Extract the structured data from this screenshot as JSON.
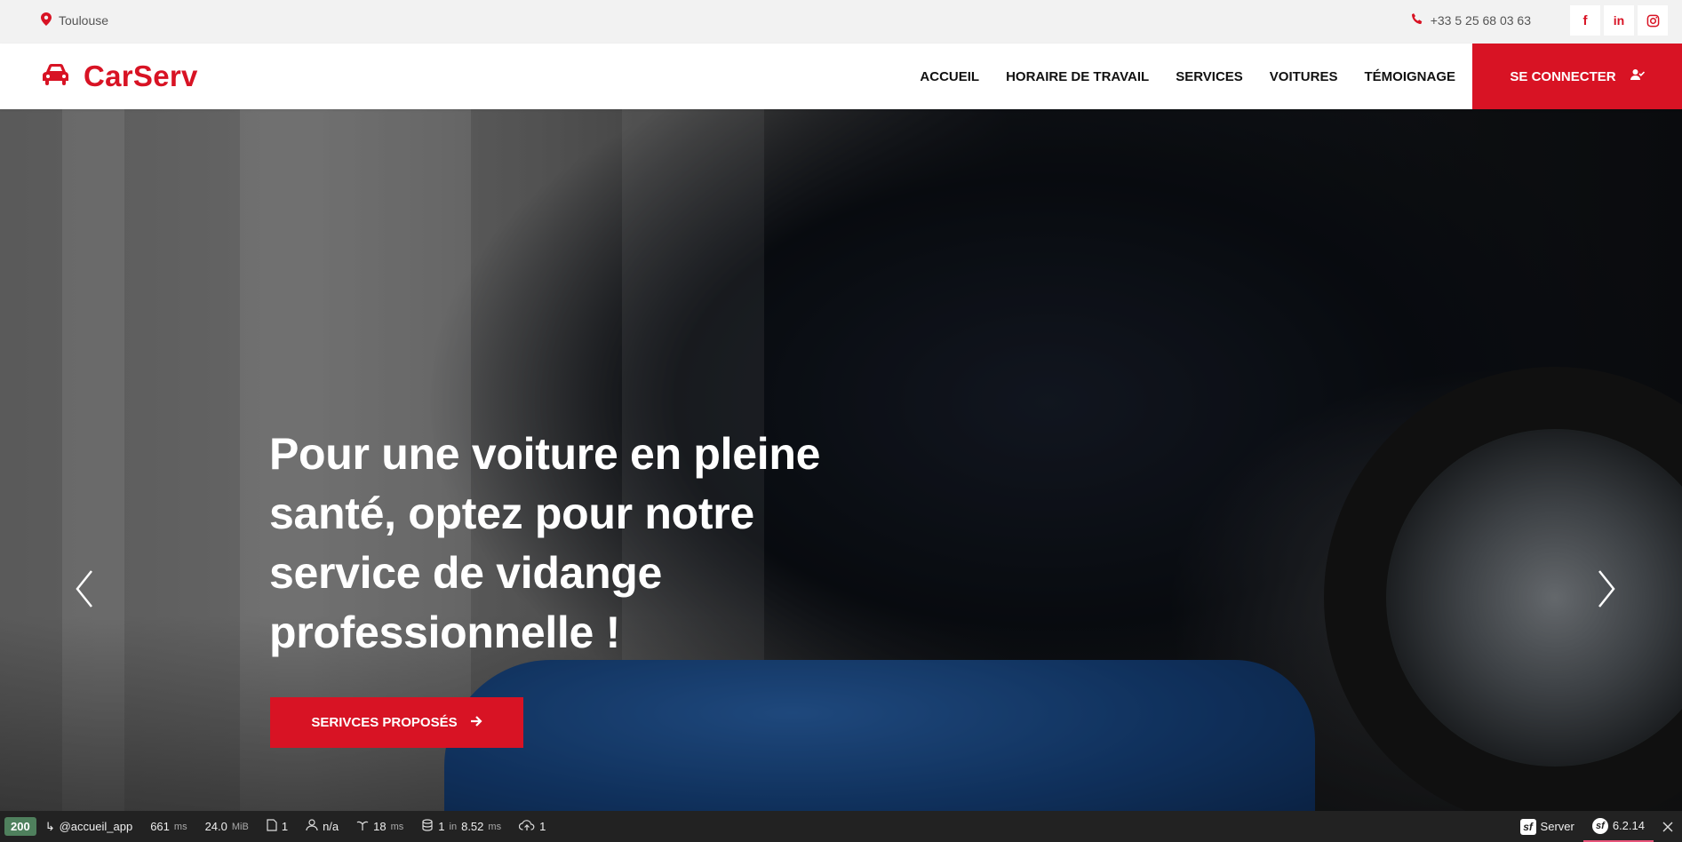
{
  "topbar": {
    "location": "Toulouse",
    "phone": "+33 5 25 68 03 63",
    "social": [
      "f",
      "in",
      "ig"
    ]
  },
  "navbar": {
    "brand": "CarServ",
    "links": [
      "ACCUEIL",
      "HORAIRE DE TRAVAIL",
      "SERVICES",
      "VOITURES",
      "TÉMOIGNAGE"
    ],
    "login": "SE CONNECTER"
  },
  "hero": {
    "headline": "Pour une voiture en pleine santé, optez pour notre service de vidange professionnelle !",
    "cta": "SERIVCES PROPOSÉS"
  },
  "debug": {
    "status": "200",
    "route": "@accueil_app",
    "time": "661",
    "time_unit": "ms",
    "memory": "24.0",
    "memory_unit": "MiB",
    "forms": "1",
    "user": "n/a",
    "twig_time": "18",
    "twig_unit": "ms",
    "db_count": "1",
    "db_in": "in",
    "db_time": "8.52",
    "db_unit": "ms",
    "uploads": "1",
    "server": "Server",
    "version": "6.2.14"
  },
  "colors": {
    "primary": "#D81324",
    "dark": "#0B2154",
    "debug_status": "#4f805d"
  }
}
